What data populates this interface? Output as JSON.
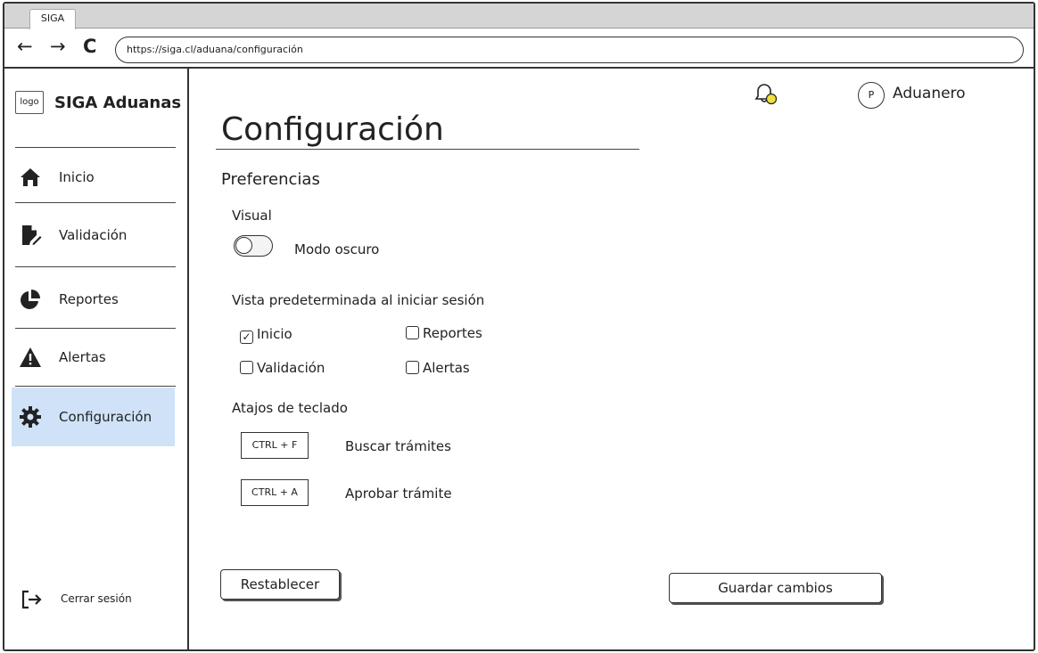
{
  "browser": {
    "tab_title": "SIGA",
    "url": "https://siga.cl/aduana/configuración",
    "back_glyph": "←",
    "forward_glyph": "→",
    "reload_glyph": "C"
  },
  "sidebar": {
    "logo_text": "logo",
    "brand": "SIGA Aduanas",
    "items": [
      {
        "label": "Inicio",
        "icon": "home-icon",
        "active": false
      },
      {
        "label": "Validación",
        "icon": "file-edit-icon",
        "active": false
      },
      {
        "label": "Reportes",
        "icon": "pie-chart-icon",
        "active": false
      },
      {
        "label": "Alertas",
        "icon": "warning-icon",
        "active": false
      },
      {
        "label": "Configuración",
        "icon": "gear-icon",
        "active": true
      }
    ],
    "logout_label": "Cerrar sesión"
  },
  "header": {
    "avatar_initial": "P",
    "username": "Aduanero",
    "notification_icon": "bell-icon"
  },
  "page": {
    "title": "Configuración",
    "section_title": "Preferencias",
    "visual": {
      "heading": "Visual",
      "dark_mode_label": "Modo oscuro",
      "dark_mode_on": false
    },
    "default_view": {
      "heading": "Vista predeterminada al iniciar sesión",
      "options": [
        {
          "label": "Inicio",
          "checked": true
        },
        {
          "label": "Reportes",
          "checked": false
        },
        {
          "label": "Validación",
          "checked": false
        },
        {
          "label": "Alertas",
          "checked": false
        }
      ]
    },
    "shortcuts": {
      "heading": "Atajos de teclado",
      "items": [
        {
          "keys": "CTRL + F",
          "action": "Buscar trámites"
        },
        {
          "keys": "CTRL + A",
          "action": "Aprobar trámite"
        }
      ]
    },
    "buttons": {
      "reset": "Restablecer",
      "save": "Guardar cambios"
    }
  },
  "colors": {
    "active_nav_bg": "#cfe2f8",
    "bell_dot": "#f3e03a"
  }
}
